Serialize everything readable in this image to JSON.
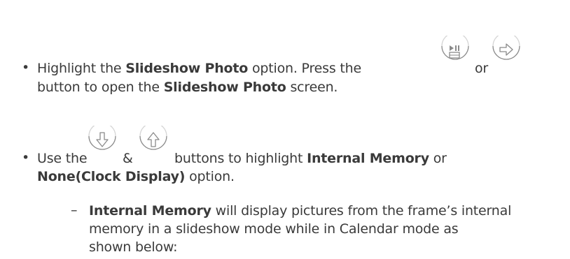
{
  "bullet1": {
    "line1_pre": "Highlight the ",
    "line1_bold": "Slideshow Photo",
    "line1_mid": " option. Press the",
    "line1_or": "or",
    "line2_pre": "button to open the ",
    "line2_bold": "Slideshow Photo",
    "line2_post": " screen.",
    "icons": [
      "play-pause-button-icon",
      "right-arrow-button-icon"
    ]
  },
  "bullet2": {
    "line1_pre": "Use the",
    "line1_amp": "&",
    "line1_mid": "buttons to highlight ",
    "line1_bold": "Internal Memory",
    "line1_post": " or",
    "line2_bold": "None(Clock Display)",
    "line2_post": " option.",
    "icons": [
      "down-arrow-button-icon",
      "up-arrow-button-icon"
    ]
  },
  "subitem": {
    "dash": "–",
    "line1_bold": "Internal Memory",
    "line1_post": " will display pictures from the frame’s internal",
    "line2": "memory in a slideshow mode while in Calendar mode as",
    "line3": "shown below:"
  }
}
